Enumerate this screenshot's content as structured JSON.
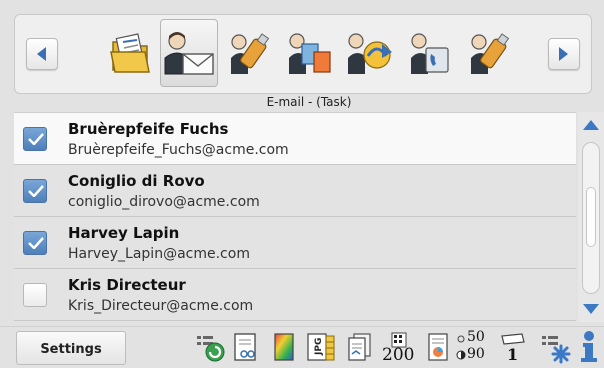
{
  "toolbar": {
    "nav_left": "left-arrow",
    "nav_right": "right-arrow",
    "tools": [
      {
        "icon": "folder-document-icon",
        "selected": false
      },
      {
        "icon": "user-email-icon",
        "selected": true
      },
      {
        "icon": "usb-stick-icon",
        "selected": false
      },
      {
        "icon": "user-fax-icon",
        "selected": false
      },
      {
        "icon": "user-network-share-icon",
        "selected": false
      },
      {
        "icon": "user-phone-icon",
        "selected": false
      },
      {
        "icon": "usb-stick-icon",
        "selected": false
      }
    ]
  },
  "list": {
    "header": "E-mail - (Task)",
    "rows": [
      {
        "name": "Bruèrepfeife Fuchs",
        "email": "Bruèrepfeife_Fuchs@acme.com",
        "checked": true
      },
      {
        "name": "Coniglio di Rovo",
        "email": "coniglio_dirovo@acme.com",
        "checked": true
      },
      {
        "name": "Harvey Lapin",
        "email": "Harvey_Lapin@acme.com",
        "checked": true
      },
      {
        "name": "Kris Directeur",
        "email": "Kris_Directeur@acme.com",
        "checked": false
      }
    ]
  },
  "statusbar": {
    "settings_label": "Settings",
    "copies": "200",
    "brightness_top": "50",
    "brightness_bottom": "90",
    "pages": "1"
  },
  "colors": {
    "check_blue": "#5b8ac4",
    "scroll_arrow_blue": "#3d78c2",
    "frame_gray": "#e2e2e2"
  }
}
